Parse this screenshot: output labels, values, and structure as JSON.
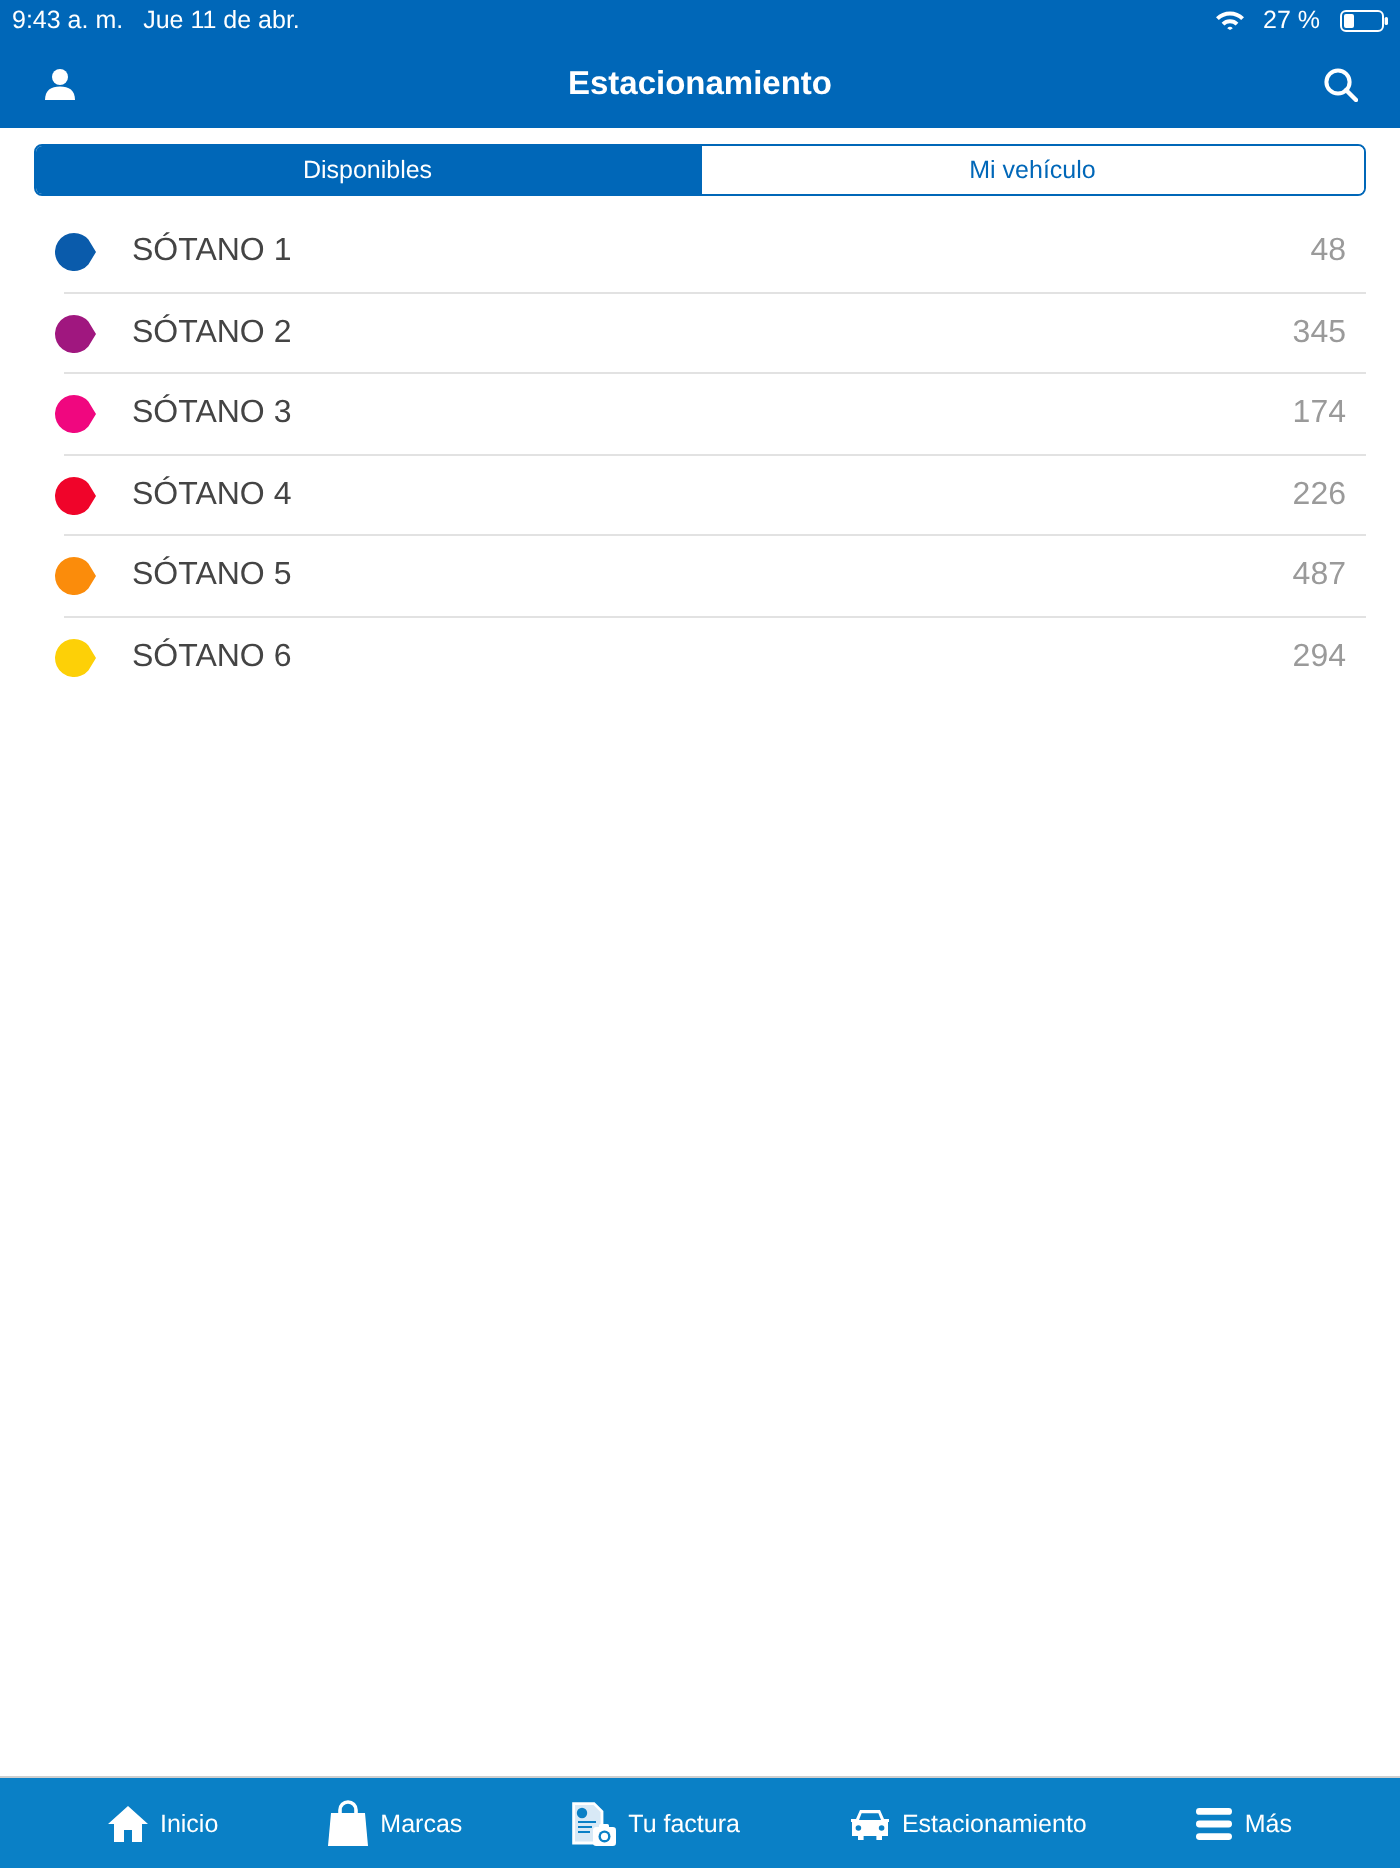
{
  "status_bar": {
    "time": "9:43 a. m.",
    "date": "Jue 11 de abr.",
    "battery": "27 %"
  },
  "header": {
    "title": "Estacionamiento"
  },
  "segments": [
    {
      "label": "Disponibles",
      "selected": true
    },
    {
      "label": "Mi vehículo",
      "selected": false
    }
  ],
  "levels": [
    {
      "name": "SÓTANO 1",
      "count": "48",
      "color": "#0a5bab"
    },
    {
      "name": "SÓTANO 2",
      "count": "345",
      "color": "#a0177f"
    },
    {
      "name": "SÓTANO 3",
      "count": "174",
      "color": "#f0077f"
    },
    {
      "name": "SÓTANO 4",
      "count": "226",
      "color": "#f0042a"
    },
    {
      "name": "SÓTANO 5",
      "count": "487",
      "color": "#fb8c0b"
    },
    {
      "name": "SÓTANO 6",
      "count": "294",
      "color": "#fdd007"
    }
  ],
  "tab_bar": [
    {
      "label": "Inicio"
    },
    {
      "label": "Marcas"
    },
    {
      "label": "Tu factura"
    },
    {
      "label": "Estacionamiento"
    },
    {
      "label": "Más"
    }
  ]
}
